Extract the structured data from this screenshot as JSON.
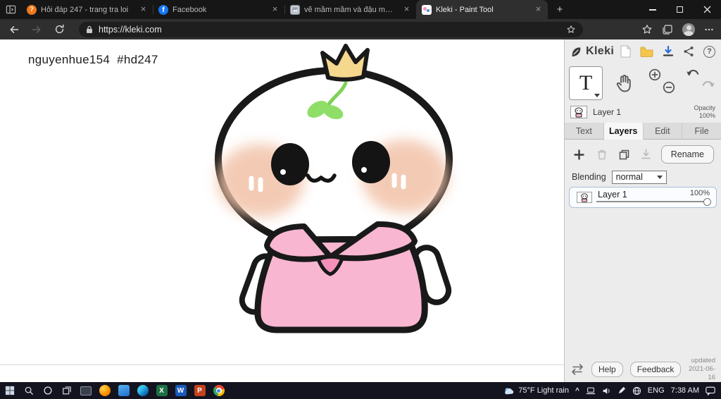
{
  "icons": {
    "close": "×",
    "plus": "+",
    "chevron_up": "^",
    "help": "?"
  },
  "browser": {
    "tabs": [
      {
        "title": "Hỏi đáp 247 - trang tra loi",
        "glyph": "?"
      },
      {
        "title": "Facebook",
        "glyph": "f"
      },
      {
        "title": "vẽ mầm mầm và đậu mầm =>nl"
      },
      {
        "title": "Kleki - Paint Tool"
      }
    ],
    "address": "https://kleki.com"
  },
  "canvas": {
    "annotation": "nguyenhue154  #hd247"
  },
  "kleki": {
    "brand": "Kleki",
    "text_tool_letter": "T",
    "layer_preview": {
      "name": "Layer 1",
      "opacity_label": "Opacity",
      "opacity_value": "100%"
    },
    "tabs": [
      {
        "label": "Text"
      },
      {
        "label": "Layers"
      },
      {
        "label": "Edit"
      },
      {
        "label": "File"
      }
    ],
    "rename_label": "Rename",
    "blending_label": "Blending",
    "blending_value": "normal",
    "layer_row": {
      "name": "Layer 1",
      "opacity": "100%"
    },
    "footer": {
      "help": "Help",
      "feedback": "Feedback",
      "updated_line1": "updated",
      "updated_line2": "2021-06-16"
    }
  },
  "taskbar": {
    "weather": "75°F Light rain",
    "language": "ENG",
    "time": "7:38 AM",
    "excel_letter": "X",
    "word_letter": "W",
    "powerpoint_letter": "P"
  },
  "colors": {
    "kleki_pink": "#f9b6d0",
    "blush_peach": "#f2c3a9",
    "crown_gold": "#f5d78e",
    "sprout_green": "#8ede68",
    "facebook_blue": "#1877f2",
    "excel_green": "#1d7044",
    "word_blue": "#185abd",
    "powerpoint_orange": "#c4431d"
  }
}
